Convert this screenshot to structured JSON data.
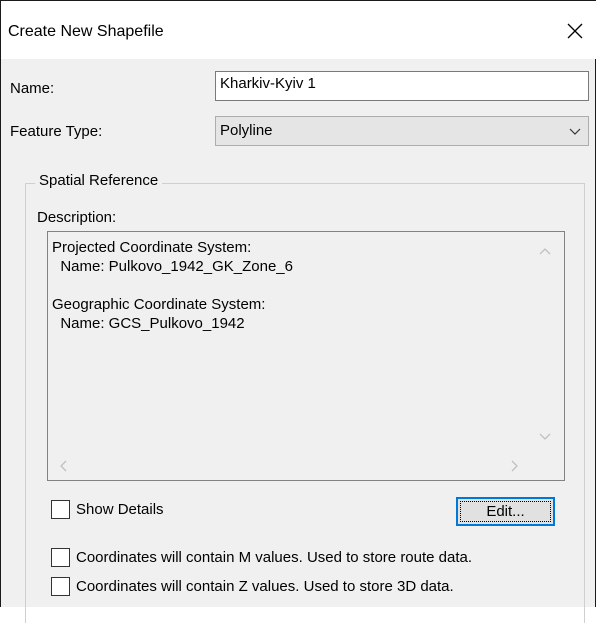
{
  "window": {
    "title": "Create New Shapefile",
    "close_icon": "close-icon"
  },
  "form": {
    "name_label": "Name:",
    "name_value": "Kharkiv-Kyiv 1",
    "feature_type_label": "Feature Type:",
    "feature_type_value": "Polyline"
  },
  "spatial_reference": {
    "group_title": "Spatial Reference",
    "description_label": "Description:",
    "description_text": "Projected Coordinate System:\n  Name: Pulkovo_1942_GK_Zone_6\n\nGeographic Coordinate System:\n  Name: GCS_Pulkovo_1942",
    "show_details_label": "Show Details",
    "show_details_checked": false,
    "edit_button_label": "Edit..."
  },
  "options": {
    "m_values_label": "Coordinates will contain M values. Used to store route data.",
    "m_values_checked": false,
    "z_values_label": "Coordinates will contain Z values. Used to store 3D data.",
    "z_values_checked": false
  },
  "colors": {
    "dialog_bg": "#f0f0f0",
    "titlebar_bg": "#ffffff",
    "focus_blue": "#0078d7",
    "scroll_arrow": "#c0c0c0"
  }
}
